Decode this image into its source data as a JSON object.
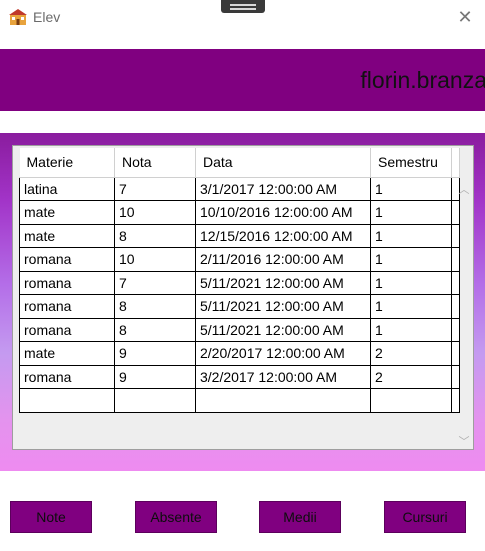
{
  "window": {
    "title": "Elev",
    "icon": "school-building-icon",
    "close_icon": "close-icon"
  },
  "banner": {
    "username": "florin.branza"
  },
  "grid": {
    "columns": [
      "Materie",
      "Nota",
      "Data",
      "Semestru"
    ],
    "rows": [
      [
        "latina",
        "7",
        "3/1/2017 12:00:00 AM",
        "1"
      ],
      [
        "mate",
        "10",
        "10/10/2016 12:00:00 AM",
        "1"
      ],
      [
        "mate",
        "8",
        "12/15/2016 12:00:00 AM",
        "1"
      ],
      [
        "romana",
        "10",
        "2/11/2016 12:00:00 AM",
        "1"
      ],
      [
        "romana",
        "7",
        "5/11/2021 12:00:00 AM",
        "1"
      ],
      [
        "romana",
        "8",
        "5/11/2021 12:00:00 AM",
        "1"
      ],
      [
        "romana",
        "8",
        "5/11/2021 12:00:00 AM",
        "1"
      ],
      [
        "mate",
        "9",
        "2/20/2017 12:00:00 AM",
        "2"
      ],
      [
        "romana",
        "9",
        "3/2/2017 12:00:00 AM",
        "2"
      ],
      [
        "",
        "",
        "",
        ""
      ]
    ]
  },
  "buttons": {
    "note": "Note",
    "absente": "Absente",
    "medii": "Medii",
    "cursuri": "Cursuri"
  },
  "colors": {
    "accent": "#800080",
    "panel_top": "#8a1c9e",
    "panel_bottom": "#ee8bf0"
  }
}
